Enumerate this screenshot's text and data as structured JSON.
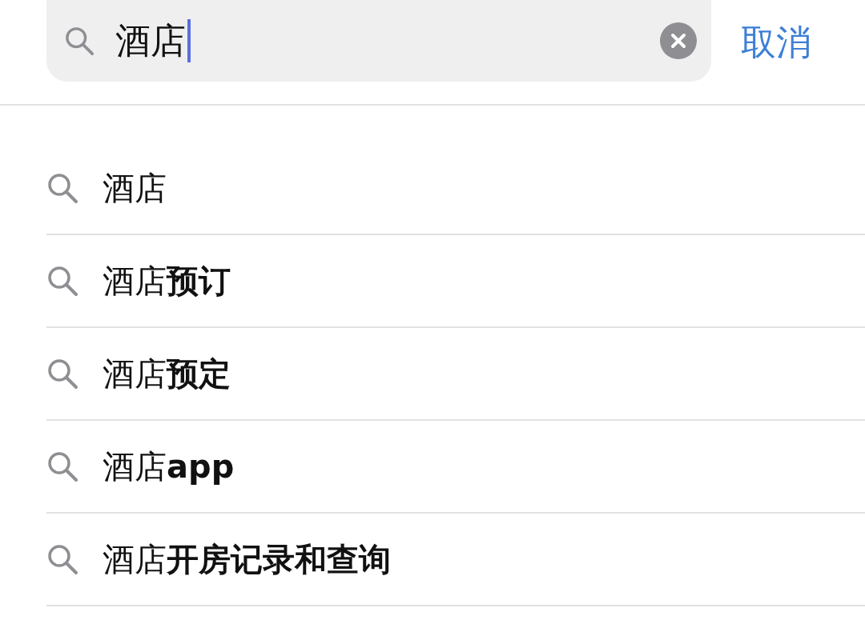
{
  "search": {
    "value": "酒店",
    "focused": true,
    "cancel": "取消"
  },
  "suggestions": [
    {
      "text": "酒店"
    },
    {
      "text": "酒店**预订**"
    },
    {
      "text": "酒店**预定**"
    },
    {
      "text": "酒店**app**"
    },
    {
      "text": "酒店**开房记录和查询**"
    }
  ]
}
